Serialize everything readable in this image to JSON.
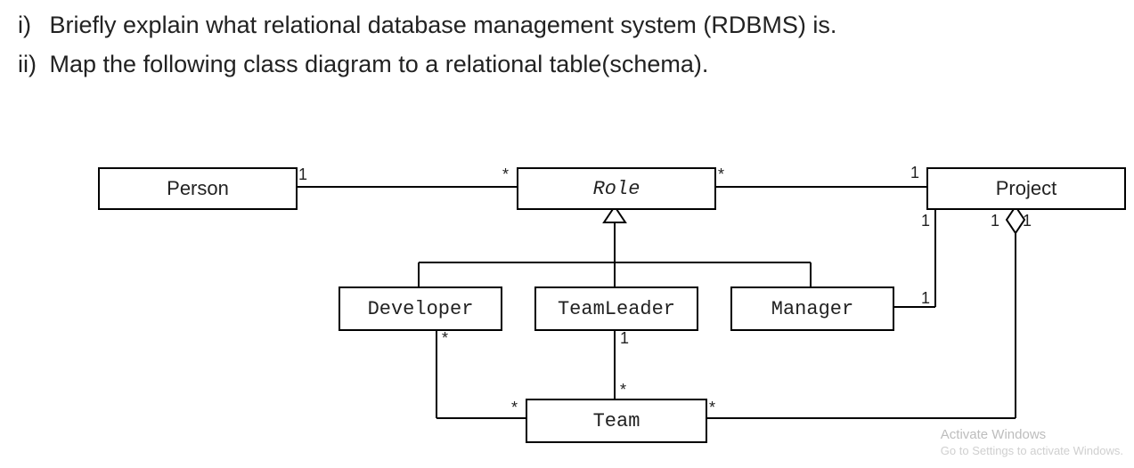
{
  "questions": {
    "i_num": "i)",
    "i_text": "Briefly explain what relational database management system (RDBMS) is.",
    "ii_num": "ii)",
    "ii_text": "Map the following class diagram to a relational table(schema)."
  },
  "classes": {
    "person": "Person",
    "role": "Role",
    "project": "Project",
    "developer": "Developer",
    "teamleader": "TeamLeader",
    "manager": "Manager",
    "team": "Team"
  },
  "mult": {
    "person_role_person": "1",
    "person_role_role": "*",
    "role_project_role": "*",
    "role_project_project": "1",
    "project_team_project": "1",
    "project_team_team": "*",
    "project_manager_project": "1",
    "project_manager_manager": "1",
    "developer_team_dev": "*",
    "developer_team_team": "*",
    "teamleader_team_tl": "1",
    "teamleader_team_team": "*"
  },
  "watermark": {
    "line1": "Activate Windows",
    "line2": "Go to Settings to activate Windows."
  },
  "chart_data": {
    "type": "uml_class_diagram",
    "classes": [
      "Person",
      "Role",
      "Project",
      "Developer",
      "TeamLeader",
      "Manager",
      "Team"
    ],
    "generalizations": [
      {
        "parent": "Role",
        "children": [
          "Developer",
          "TeamLeader",
          "Manager"
        ]
      }
    ],
    "aggregations": [
      {
        "whole": "Project",
        "part": "Team",
        "whole_mult": "1",
        "part_mult": "*"
      }
    ],
    "associations": [
      {
        "a": "Person",
        "a_mult": "1",
        "b": "Role",
        "b_mult": "*"
      },
      {
        "a": "Role",
        "a_mult": "*",
        "b": "Project",
        "b_mult": "1"
      },
      {
        "a": "Manager",
        "a_mult": "1",
        "b": "Project",
        "b_mult": "1"
      },
      {
        "a": "Developer",
        "a_mult": "*",
        "b": "Team",
        "b_mult": "*"
      },
      {
        "a": "TeamLeader",
        "a_mult": "1",
        "b": "Team",
        "b_mult": "*"
      }
    ]
  }
}
